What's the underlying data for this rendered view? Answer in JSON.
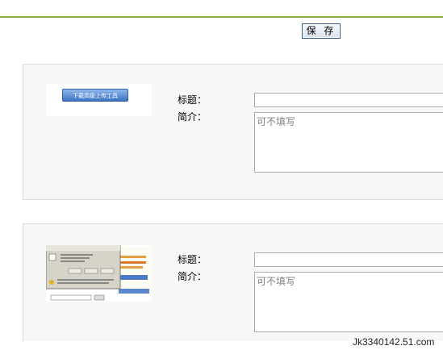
{
  "toolbar": {
    "save_label": "保 存"
  },
  "items": [
    {
      "thumbnail_button_text": "下载高级上传工具",
      "title_label": "标题：",
      "title_value": "",
      "desc_label": "简介：",
      "desc_placeholder": "可不填写"
    },
    {
      "title_label": "标题：",
      "title_value": "",
      "desc_label": "简介：",
      "desc_placeholder": "可不填写"
    }
  ],
  "watermark": "Jk3340142.51.com",
  "colors": {
    "accent_line": "#8aaa46",
    "panel_bg": "#f7f7f7",
    "input_border": "#a5acb5"
  }
}
